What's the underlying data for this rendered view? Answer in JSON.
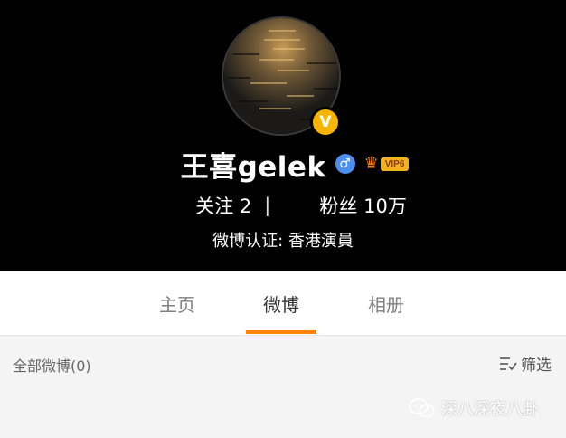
{
  "profile": {
    "username": "王喜gelek",
    "verified_mark": "V",
    "gender_symbol": "♂",
    "vip_label": "VIP6",
    "vip_crown": "♛",
    "following_label": "关注",
    "following_count": "2",
    "stat_separator": "|",
    "followers_label": "粉丝",
    "followers_count": "10万",
    "certification": "微博认证: 香港演員"
  },
  "tabs": [
    {
      "label": "主页",
      "active": false
    },
    {
      "label": "微博",
      "active": true
    },
    {
      "label": "相册",
      "active": false
    }
  ],
  "feed": {
    "all_posts_label": "全部微博(0)",
    "filter_label": "筛选"
  },
  "watermark": {
    "text": "深八深夜八卦"
  },
  "colors": {
    "header_bg": "#000000",
    "accent": "#ff8200",
    "verified": "#f7b500",
    "gender": "#4c8ff0"
  }
}
